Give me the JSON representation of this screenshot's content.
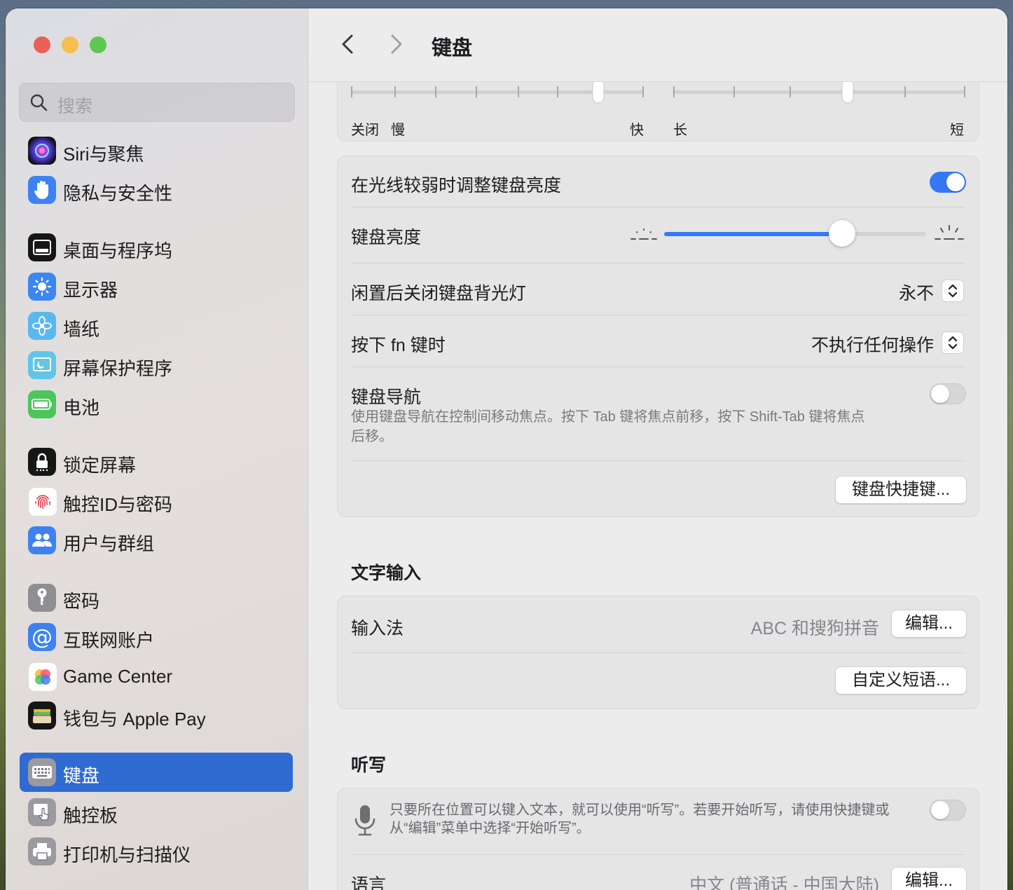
{
  "window": {
    "title": "键盘"
  },
  "sidebar": {
    "search_placeholder": "搜索",
    "items": [
      {
        "label": "Siri与聚焦",
        "icon": "siri-icon"
      },
      {
        "label": "隐私与安全性",
        "icon": "hand-icon"
      },
      {
        "label": "桌面与程序坞",
        "icon": "dock-icon"
      },
      {
        "label": "显示器",
        "icon": "sun-icon"
      },
      {
        "label": "墙纸",
        "icon": "flower-icon"
      },
      {
        "label": "屏幕保护程序",
        "icon": "screensaver-icon"
      },
      {
        "label": "电池",
        "icon": "battery-icon"
      },
      {
        "label": "锁定屏幕",
        "icon": "lock-icon"
      },
      {
        "label": "触控ID与密码",
        "icon": "fingerprint-icon"
      },
      {
        "label": "用户与群组",
        "icon": "users-icon"
      },
      {
        "label": "密码",
        "icon": "key-icon"
      },
      {
        "label": "互联网账户",
        "icon": "at-icon"
      },
      {
        "label": "Game Center",
        "icon": "game-center-icon"
      },
      {
        "label": "钱包与 Apple Pay",
        "icon": "wallet-icon"
      },
      {
        "label": "键盘",
        "icon": "keyboard-icon",
        "selected": true
      },
      {
        "label": "触控板",
        "icon": "trackpad-icon"
      },
      {
        "label": "打印机与扫描仪",
        "icon": "printer-icon"
      }
    ]
  },
  "sliders_top": {
    "repeat_labels": {
      "off": "关闭",
      "slow": "慢",
      "fast": "快"
    },
    "delay_labels": {
      "long": "长",
      "short": "短"
    }
  },
  "keyboard": {
    "auto_brightness_label": "在光线较弱时调整键盘亮度",
    "auto_brightness_on": true,
    "brightness_label": "键盘亮度",
    "brightness_value": 0.68,
    "backlight_off_label": "闲置后关闭键盘背光灯",
    "backlight_off_value": "永不",
    "fn_label": "按下 fn 键时",
    "fn_value": "不执行任何操作",
    "nav_label": "键盘导航",
    "nav_desc": "使用键盘导航在控制间移动焦点。按下 Tab 键将焦点前移，按下 Shift-Tab 键将焦点后移。",
    "nav_on": false,
    "shortcuts_button": "键盘快捷键..."
  },
  "text_input": {
    "section_title": "文字输入",
    "input_method_label": "输入法",
    "input_method_value": "ABC 和搜狗拼音",
    "edit_button": "编辑...",
    "custom_phrases_button": "自定义短语..."
  },
  "dictation": {
    "section_title": "听写",
    "desc": "只要所在位置可以键入文本，就可以使用“听写”。若要开始听写，请使用快捷键或从“编辑”菜单中选择“开始听写”。",
    "enabled": false,
    "language_label": "语言",
    "language_value": "中文 (普通话 - 中国大陆)",
    "edit_button": "编辑..."
  },
  "colors": {
    "accent": "#2f6bd0",
    "toggle_on": "#3478f6"
  }
}
